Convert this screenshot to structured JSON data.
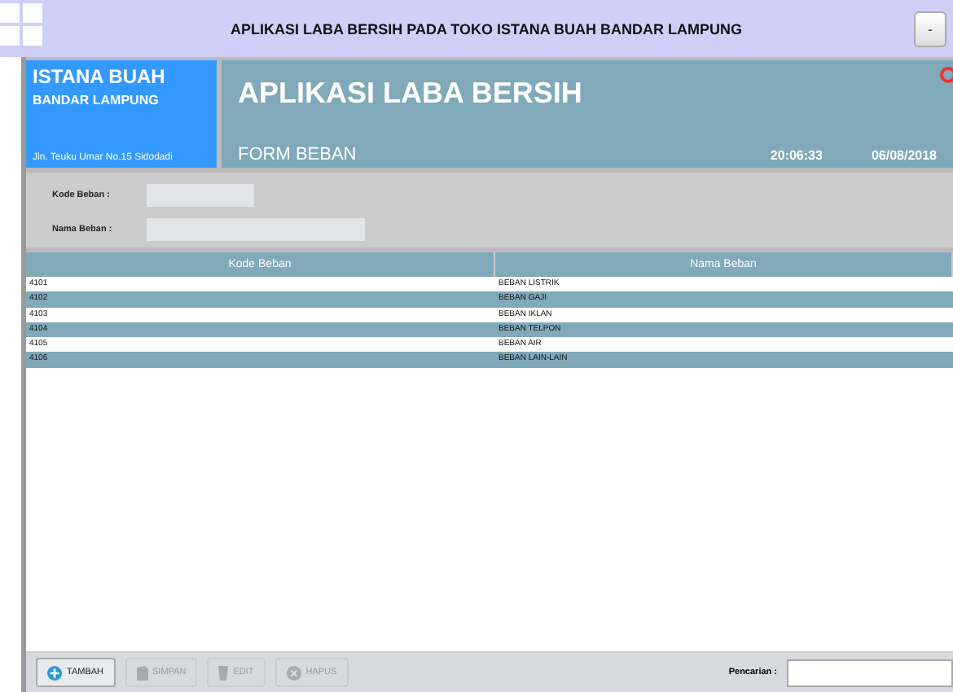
{
  "window": {
    "title": "APLIKASI LABA BERSIH PADA TOKO ISTANA BUAH BANDAR LAMPUNG",
    "minimize": "-"
  },
  "brand": {
    "name": "ISTANA BUAH",
    "city": "BANDAR LAMPUNG",
    "address": "Jln. Teuku Umar No.15 Sidodadi"
  },
  "header": {
    "title": "APLIKASI LABA BERSIH",
    "form": "FORM BEBAN",
    "time": "20:06:33",
    "date": "06/08/2018"
  },
  "form": {
    "fields": [
      {
        "label": "Kode Beban :",
        "kind": "short"
      },
      {
        "label": "Nama Beban :",
        "kind": "long"
      }
    ]
  },
  "table": {
    "columns": [
      "Kode Beban",
      "Nama Beban"
    ],
    "rows": [
      [
        "4101",
        "BEBAN LISTRIK"
      ],
      [
        "4102",
        "BEBAN GAJI"
      ],
      [
        "4103",
        "BEBAN IKLAN"
      ],
      [
        "4104",
        "BEBAN TELPON"
      ],
      [
        "4105",
        "BEBAN AIR"
      ],
      [
        "4106",
        "BEBAN LAIN-LAIN"
      ]
    ]
  },
  "toolbar": {
    "buttons": [
      {
        "label": "TAMBAH",
        "kind": "add",
        "disabled": false
      },
      {
        "label": "SIMPAN",
        "kind": "save",
        "disabled": true
      },
      {
        "label": "EDIT",
        "kind": "edit",
        "disabled": true
      },
      {
        "label": "HAPUS",
        "kind": "delete",
        "disabled": true
      }
    ],
    "search_label": "Pencarian :"
  }
}
